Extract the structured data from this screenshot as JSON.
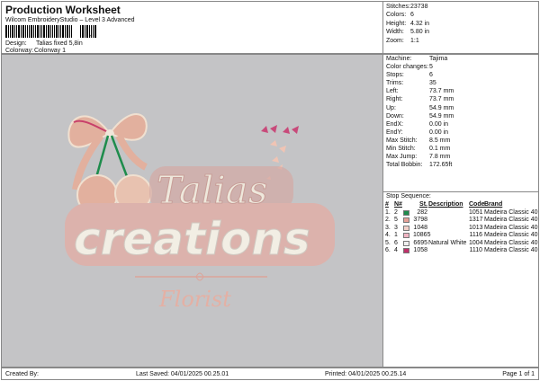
{
  "header": {
    "title": "Production Worksheet",
    "subtitle": "Wilcom EmbroideryStudio – Level 3 Advanced",
    "barcode_suffix": ",",
    "design_label": "Design:",
    "design_value": "Talias fixed 5,8in",
    "colorway_label": "Colorway:",
    "colorway_value": "Colorway 1"
  },
  "stats": [
    {
      "label": "Stitches:",
      "value": "23738"
    },
    {
      "label": "Colors:",
      "value": "6"
    },
    {
      "label": "Height:",
      "value": "4.32 in"
    },
    {
      "label": "Width:",
      "value": "5.80 in"
    },
    {
      "label": "Zoom:",
      "value": "1:1"
    }
  ],
  "details": [
    {
      "label": "Machine:",
      "value": "Tajima"
    },
    {
      "label": "Color changes:",
      "value": "5"
    },
    {
      "label": "Stops:",
      "value": "6"
    },
    {
      "label": "Trims:",
      "value": "35"
    },
    {
      "label": "Left:",
      "value": "73.7 mm"
    },
    {
      "label": "Right:",
      "value": "73.7 mm"
    },
    {
      "label": "Up:",
      "value": "54.9 mm"
    },
    {
      "label": "Down:",
      "value": "54.9 mm"
    },
    {
      "label": "EndX:",
      "value": "0.00 in"
    },
    {
      "label": "EndY:",
      "value": "0.00 in"
    },
    {
      "label": "Max Stitch:",
      "value": "8.5 mm"
    },
    {
      "label": "Min Stitch:",
      "value": "0.1 mm"
    },
    {
      "label": "Max Jump:",
      "value": "7.8 mm"
    },
    {
      "label": "Total Bobbin:",
      "value": "172.65ft"
    }
  ],
  "sequence": {
    "title": "Stop Sequence:",
    "headers": {
      "num": "#",
      "n": "N#",
      "st": "St.",
      "desc": "Description",
      "code": "Code",
      "brand": "Brand"
    },
    "rows": [
      {
        "num": "1.",
        "n": "2",
        "color": "#1e8c4c",
        "st": "282",
        "desc": "",
        "code": "1051",
        "brand": "Madeira Classic 40"
      },
      {
        "num": "2.",
        "n": "5",
        "color": "#e6a096",
        "st": "3798",
        "desc": "",
        "code": "1317",
        "brand": "Madeira Classic 40"
      },
      {
        "num": "3.",
        "n": "3",
        "color": "#f2cfc8",
        "st": "1048",
        "desc": "",
        "code": "1013",
        "brand": "Madeira Classic 40"
      },
      {
        "num": "4.",
        "n": "1",
        "color": "#efb4c2",
        "st": "10865",
        "desc": "",
        "code": "1116",
        "brand": "Madeira Classic 40"
      },
      {
        "num": "5.",
        "n": "6",
        "color": "#eeeeee",
        "st": "6695",
        "desc": "Natural White",
        "code": "1004",
        "brand": "Madeira Classic 40"
      },
      {
        "num": "6.",
        "n": "4",
        "color": "#c0306a",
        "st": "1058",
        "desc": "",
        "code": "1110",
        "brand": "Madeira Classic 40"
      }
    ]
  },
  "design_art": {
    "line1": "Talias",
    "line2": "creations",
    "line3": "Florist"
  },
  "footer": {
    "created_by": "Created By:",
    "last_saved": "Last Saved: 04/01/2025 00.25.01",
    "printed": "Printed: 04/01/2025 00.25.14",
    "page": "Page 1 of 1"
  }
}
